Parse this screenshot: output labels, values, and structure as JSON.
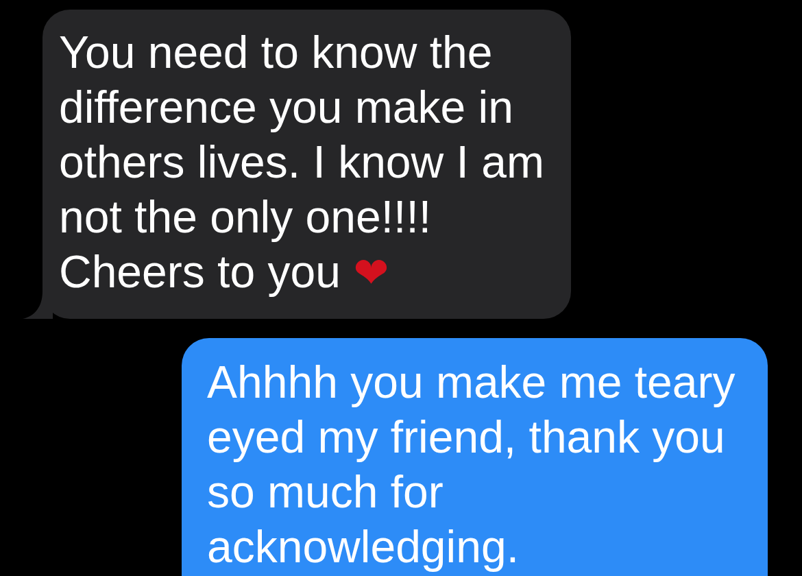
{
  "messages": [
    {
      "kind": "incoming",
      "text": "You need to know the difference you make in others lives. I know I am not the only one!!!! Cheers to you",
      "emoji": "❤"
    },
    {
      "kind": "outgoing",
      "text": "Ahhhh you make me teary eyed my friend, thank you so much for acknowledging."
    }
  ]
}
